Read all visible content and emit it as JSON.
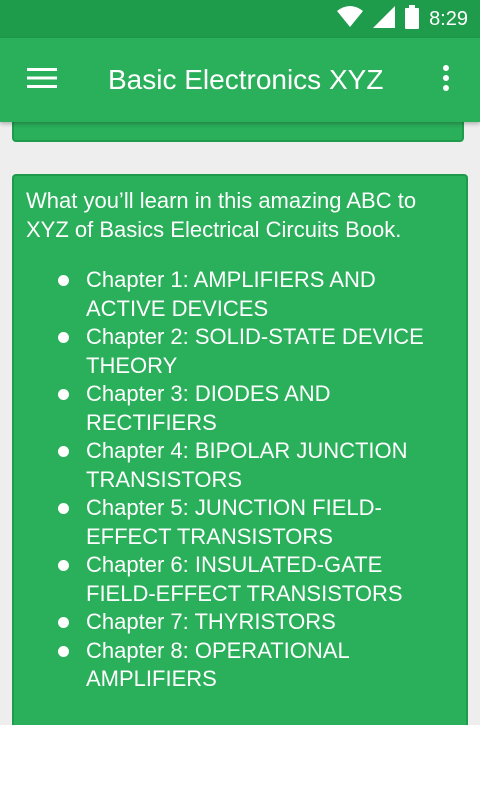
{
  "status_bar": {
    "time": "8:29",
    "icons": [
      "wifi-icon",
      "cell-signal-icon",
      "battery-icon"
    ]
  },
  "app_bar": {
    "title": "Basic Electronics XYZ",
    "menu_icon": "hamburger-menu-icon",
    "overflow_icon": "more-vert-icon"
  },
  "card": {
    "intro": "What you’ll learn in this amazing ABC to XYZ of Basics Electrical Circuits Book.",
    "chapters": [
      "Chapter 1: AMPLIFIERS AND ACTIVE DEVICES",
      "Chapter 2: SOLID-STATE DEVICE THEORY",
      "Chapter 3: DIODES AND RECTIFIERS",
      "Chapter 4: BIPOLAR JUNCTION TRANSISTORS",
      "Chapter 5: JUNCTION FIELD-EFFECT TRANSISTORS",
      "Chapter 6: INSULATED-GATE FIELD-EFFECT TRANSISTORS",
      "Chapter 7: THYRISTORS",
      "Chapter 8: OPERATIONAL AMPLIFIERS"
    ]
  },
  "colors": {
    "status_bar": "#1e9b4b",
    "app_bar": "#2aaf5a",
    "card": "#2aaf5a",
    "card_border": "#1e9b4b",
    "background": "#eeeeee",
    "text": "#ffffff"
  }
}
